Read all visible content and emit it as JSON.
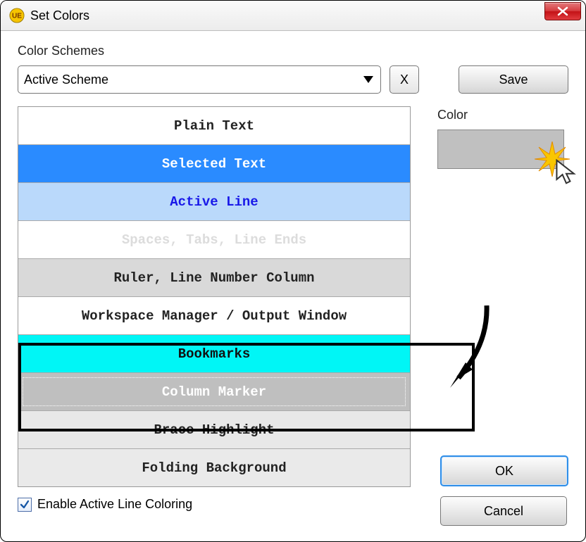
{
  "window": {
    "title": "Set Colors"
  },
  "section_label": "Color Schemes",
  "scheme": {
    "selected": "Active Scheme",
    "clear_label": "X"
  },
  "buttons": {
    "save": "Save",
    "ok": "OK",
    "cancel": "Cancel"
  },
  "color_panel": {
    "label": "Color",
    "swatch_hex": "#c0c0c0"
  },
  "items": [
    {
      "label": "Plain Text"
    },
    {
      "label": "Selected Text"
    },
    {
      "label": "Active Line"
    },
    {
      "label": "Spaces, Tabs, Line Ends"
    },
    {
      "label": "Ruler, Line Number Column"
    },
    {
      "label": "Workspace Manager / Output Window"
    },
    {
      "label": "Bookmarks"
    },
    {
      "label": "Column Marker"
    },
    {
      "label": "Brace Highlight"
    },
    {
      "label": "Folding Background"
    }
  ],
  "checkbox": {
    "label": "Enable Active Line Coloring",
    "checked": true
  }
}
